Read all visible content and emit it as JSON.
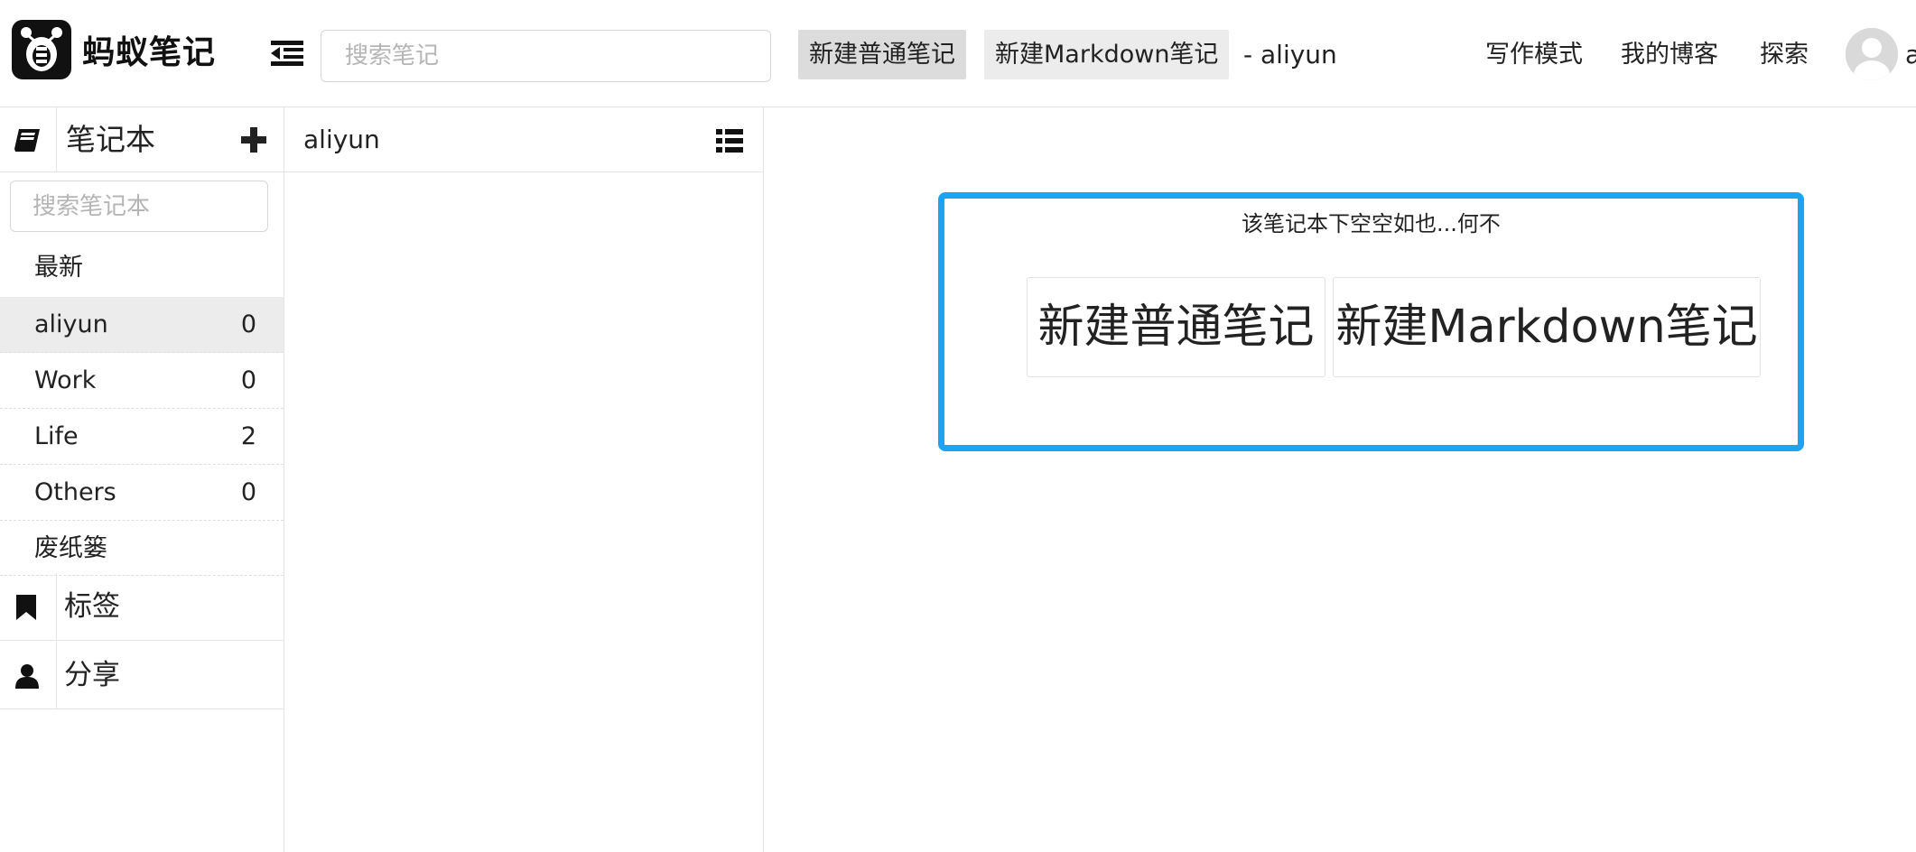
{
  "header": {
    "logo_text": "蚂蚁笔记",
    "search_placeholder": "搜索笔记",
    "new_normal_label": "新建普通笔记",
    "new_markdown_label": "新建Markdown笔记",
    "current_notebook": "- aliyun",
    "nav": {
      "write_mode": "写作模式",
      "my_blog": "我的博客",
      "explore": "探索"
    },
    "username": "a"
  },
  "sidebar": {
    "notebook_title": "笔记本",
    "notebook_search_placeholder": "搜索笔记本",
    "latest_label": "最新",
    "notebooks": [
      {
        "name": "aliyun",
        "count": "0"
      },
      {
        "name": "Work",
        "count": "0"
      },
      {
        "name": "Life",
        "count": "2"
      },
      {
        "name": "Others",
        "count": "0"
      }
    ],
    "trash_label": "废纸篓",
    "tags_label": "标签",
    "share_label": "分享"
  },
  "note_list": {
    "title": "aliyun"
  },
  "empty_panel": {
    "message": "该笔记本下空空如也...何不",
    "new_normal_label": "新建普通笔记",
    "new_markdown_label": "新建Markdown笔记"
  },
  "colors": {
    "accent": "#1ea3f2",
    "active_row": "#ececec"
  }
}
